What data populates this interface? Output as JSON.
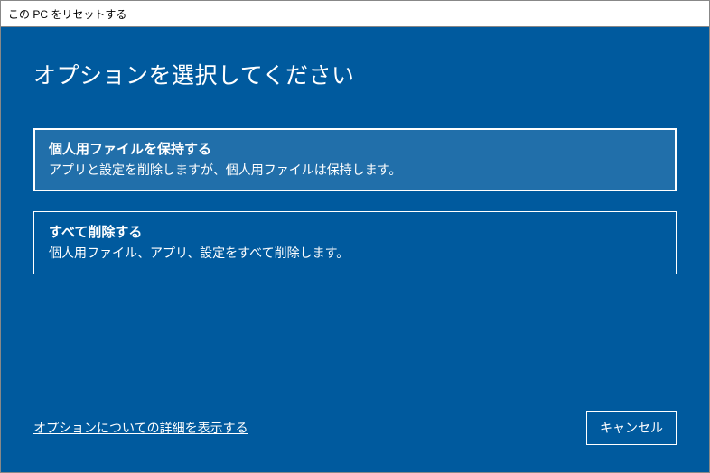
{
  "window": {
    "title": "この PC をリセットする"
  },
  "heading": "オプションを選択してください",
  "options": [
    {
      "title": "個人用ファイルを保持する",
      "description": "アプリと設定を削除しますが、個人用ファイルは保持します。",
      "highlighted": true
    },
    {
      "title": "すべて削除する",
      "description": "個人用ファイル、アプリ、設定をすべて削除します。",
      "highlighted": false
    }
  ],
  "more_link": "オプションについての詳細を表示する",
  "cancel": "キャンセル",
  "colors": {
    "background": "#005a9e",
    "text": "#ffffff",
    "border": "#ffffff"
  }
}
